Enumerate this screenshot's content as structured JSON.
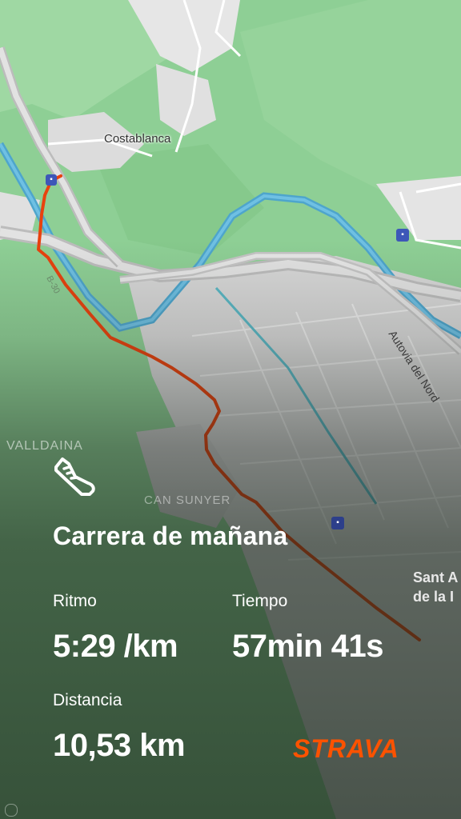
{
  "map": {
    "labels": {
      "costablanca": "Costablanca",
      "valldaina": "VALLDAINA",
      "can_sunyer": "CAN SUNYER",
      "sant_line1": "Sant A",
      "sant_line2": "de la I",
      "autovia": "Autovia del Nord",
      "road_b": "B-30"
    },
    "colors": {
      "route": "#e8420e",
      "forest": "#8ecf95",
      "urban": "#d9d9d9",
      "water": "#4ea5cc"
    }
  },
  "activity": {
    "icon": "running-shoe-icon",
    "title": "Carrera de mañana",
    "pace_label": "Ritmo",
    "pace_value": "5:29 /km",
    "time_label": "Tiempo",
    "time_value": "57min 41s",
    "distance_label": "Distancia",
    "distance_value": "10,53 km"
  },
  "brand": {
    "name": "STRAVA",
    "color": "#fc5200"
  }
}
